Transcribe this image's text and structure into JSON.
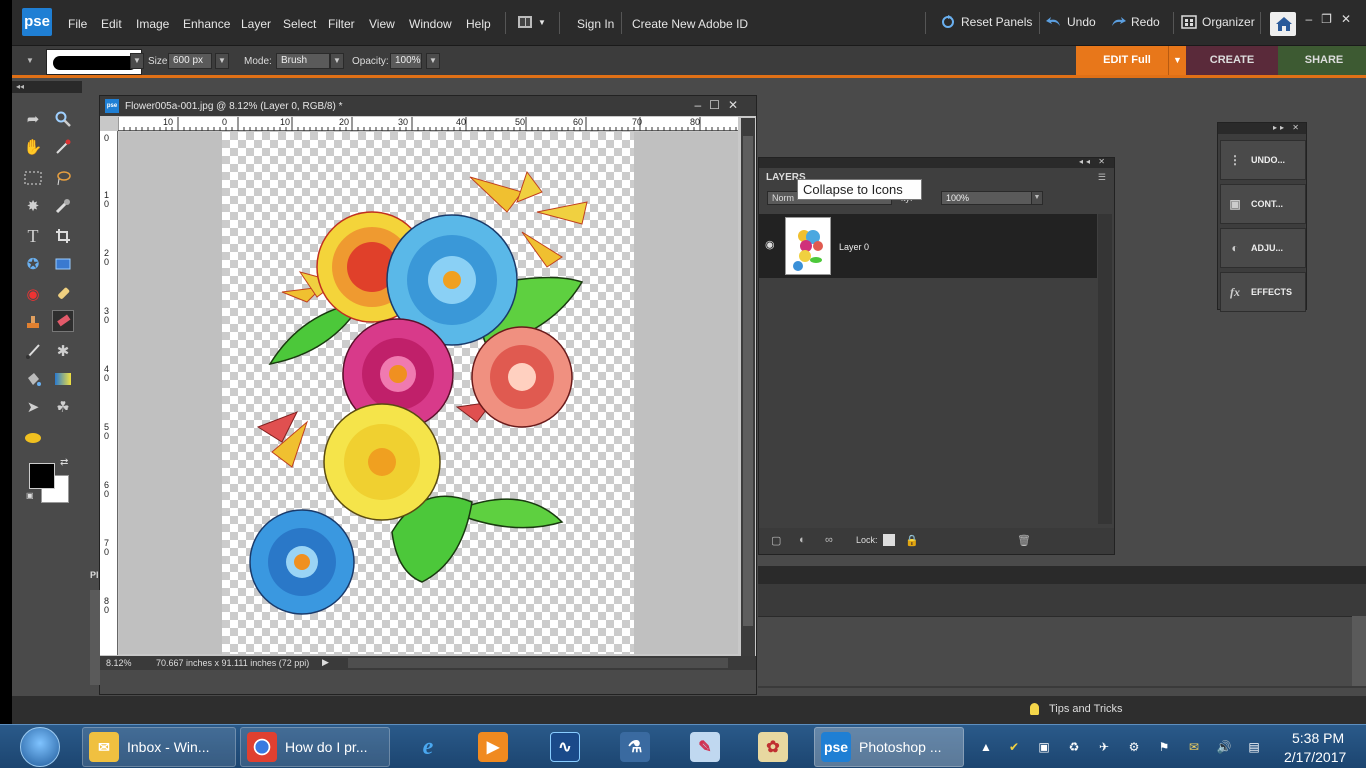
{
  "app": {
    "logo": "pse"
  },
  "menu": [
    "File",
    "Edit",
    "Image",
    "Enhance",
    "Layer",
    "Select",
    "Filter",
    "View",
    "Window",
    "Help"
  ],
  "menubar": {
    "sign_in": "Sign In",
    "create_id": "Create New Adobe ID",
    "reset_panels": "Reset Panels",
    "undo": "Undo",
    "redo": "Redo",
    "organizer": "Organizer"
  },
  "options": {
    "size_label": "Size:",
    "size_value": "600 px",
    "mode_label": "Mode:",
    "mode_value": "Brush",
    "opacity_label": "Opacity:",
    "opacity_value": "100%"
  },
  "mode_tabs": {
    "edit": "EDIT Full",
    "create": "CREATE",
    "share": "SHARE"
  },
  "document": {
    "title": "Flower005a-001.jpg @ 8.12% (Layer 0, RGB/8) *",
    "zoom": "8.12%",
    "size_info": "70.667 inches x 91.111 inches (72 ppi)",
    "ruler_h": [
      "10",
      "0",
      "10",
      "20",
      "30",
      "40",
      "50",
      "60",
      "70",
      "80"
    ],
    "ruler_v": [
      "0",
      "1 0",
      "2 0",
      "3 0",
      "4 0",
      "5 0",
      "6 0",
      "7 0",
      "8 0"
    ]
  },
  "layers": {
    "title": "LAYERS",
    "blend_mode": "Norm",
    "opacity_label": "ity:",
    "opacity_value": "100%",
    "layer_name": "Layer 0",
    "lock_label": "Lock:"
  },
  "tooltip": "Collapse to Icons",
  "icon_panel": [
    "UNDO...",
    "CONT...",
    "ADJU...",
    "EFFECTS"
  ],
  "left_dock_label": "Pl",
  "status": {
    "tips": "Tips and Tricks"
  },
  "taskbar": {
    "items": [
      "Inbox - Win...",
      "How do I pr...",
      "Photoshop ..."
    ],
    "time": "5:38 PM",
    "date": "2/17/2017"
  },
  "colors": {
    "accent": "#e8771a",
    "foreground": "#000000",
    "background": "#ffffff"
  }
}
